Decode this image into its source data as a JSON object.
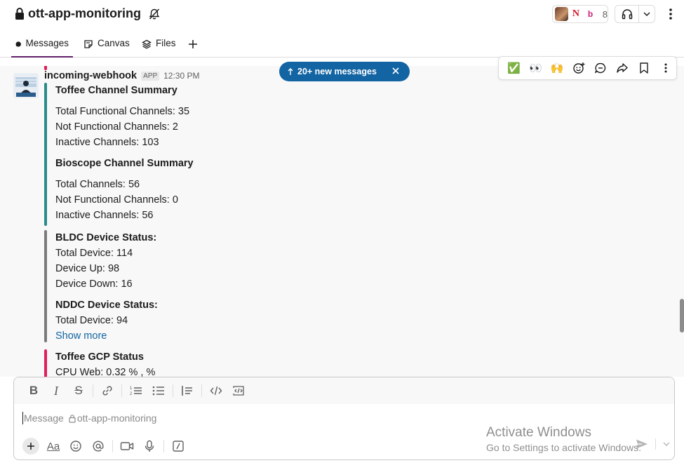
{
  "channel": {
    "name": "ott-app-monitoring",
    "member_count": "8"
  },
  "tabs": [
    {
      "label": "Messages"
    },
    {
      "label": "Canvas"
    },
    {
      "label": "Files"
    }
  ],
  "message": {
    "sender": "incoming-webhook",
    "badge": "APP",
    "time": "12:30 PM"
  },
  "attachments": {
    "toffee_summary": {
      "title": "Toffee Channel Summary",
      "lines": [
        "Total Functional Channels: 35",
        "Not Functional Channels: 2",
        "Inactive Channels: 103"
      ],
      "title2": "Bioscope Channel Summary",
      "lines2": [
        "Total Channels: 56",
        "Not Functional Channels: 0",
        "Inactive Channels: 56"
      ]
    },
    "device_status": {
      "title": "BLDC Device Status:",
      "lines": [
        "Total Device: 114",
        "Device Up: 98",
        "Device Down: 16"
      ],
      "title2": "NDDC Device Status:",
      "lines2": [
        "Total Device: 94"
      ],
      "show_more": "Show more"
    },
    "gcp_status": {
      "title": "Toffee GCP Status",
      "lines": [
        "CPU Web: 0.32 % , %"
      ]
    }
  },
  "new_messages_pill": {
    "label": "20+ new messages"
  },
  "hover_actions": {
    "emojis": [
      "✅",
      "👀",
      "🙌"
    ]
  },
  "composer": {
    "placeholder_prefix": "Message",
    "placeholder_channel": "ott-app-monitoring",
    "aa_label": "Aa"
  },
  "watermark": {
    "line1": "Activate Windows",
    "line2": "Go to Settings to activate Windows."
  },
  "colors": {
    "accent_purple": "#611f69",
    "link_blue": "#1264a3",
    "teal_bar": "#2a8a8a",
    "gray_bar": "#7a7a7a",
    "pink_bar": "#e01e5a"
  }
}
